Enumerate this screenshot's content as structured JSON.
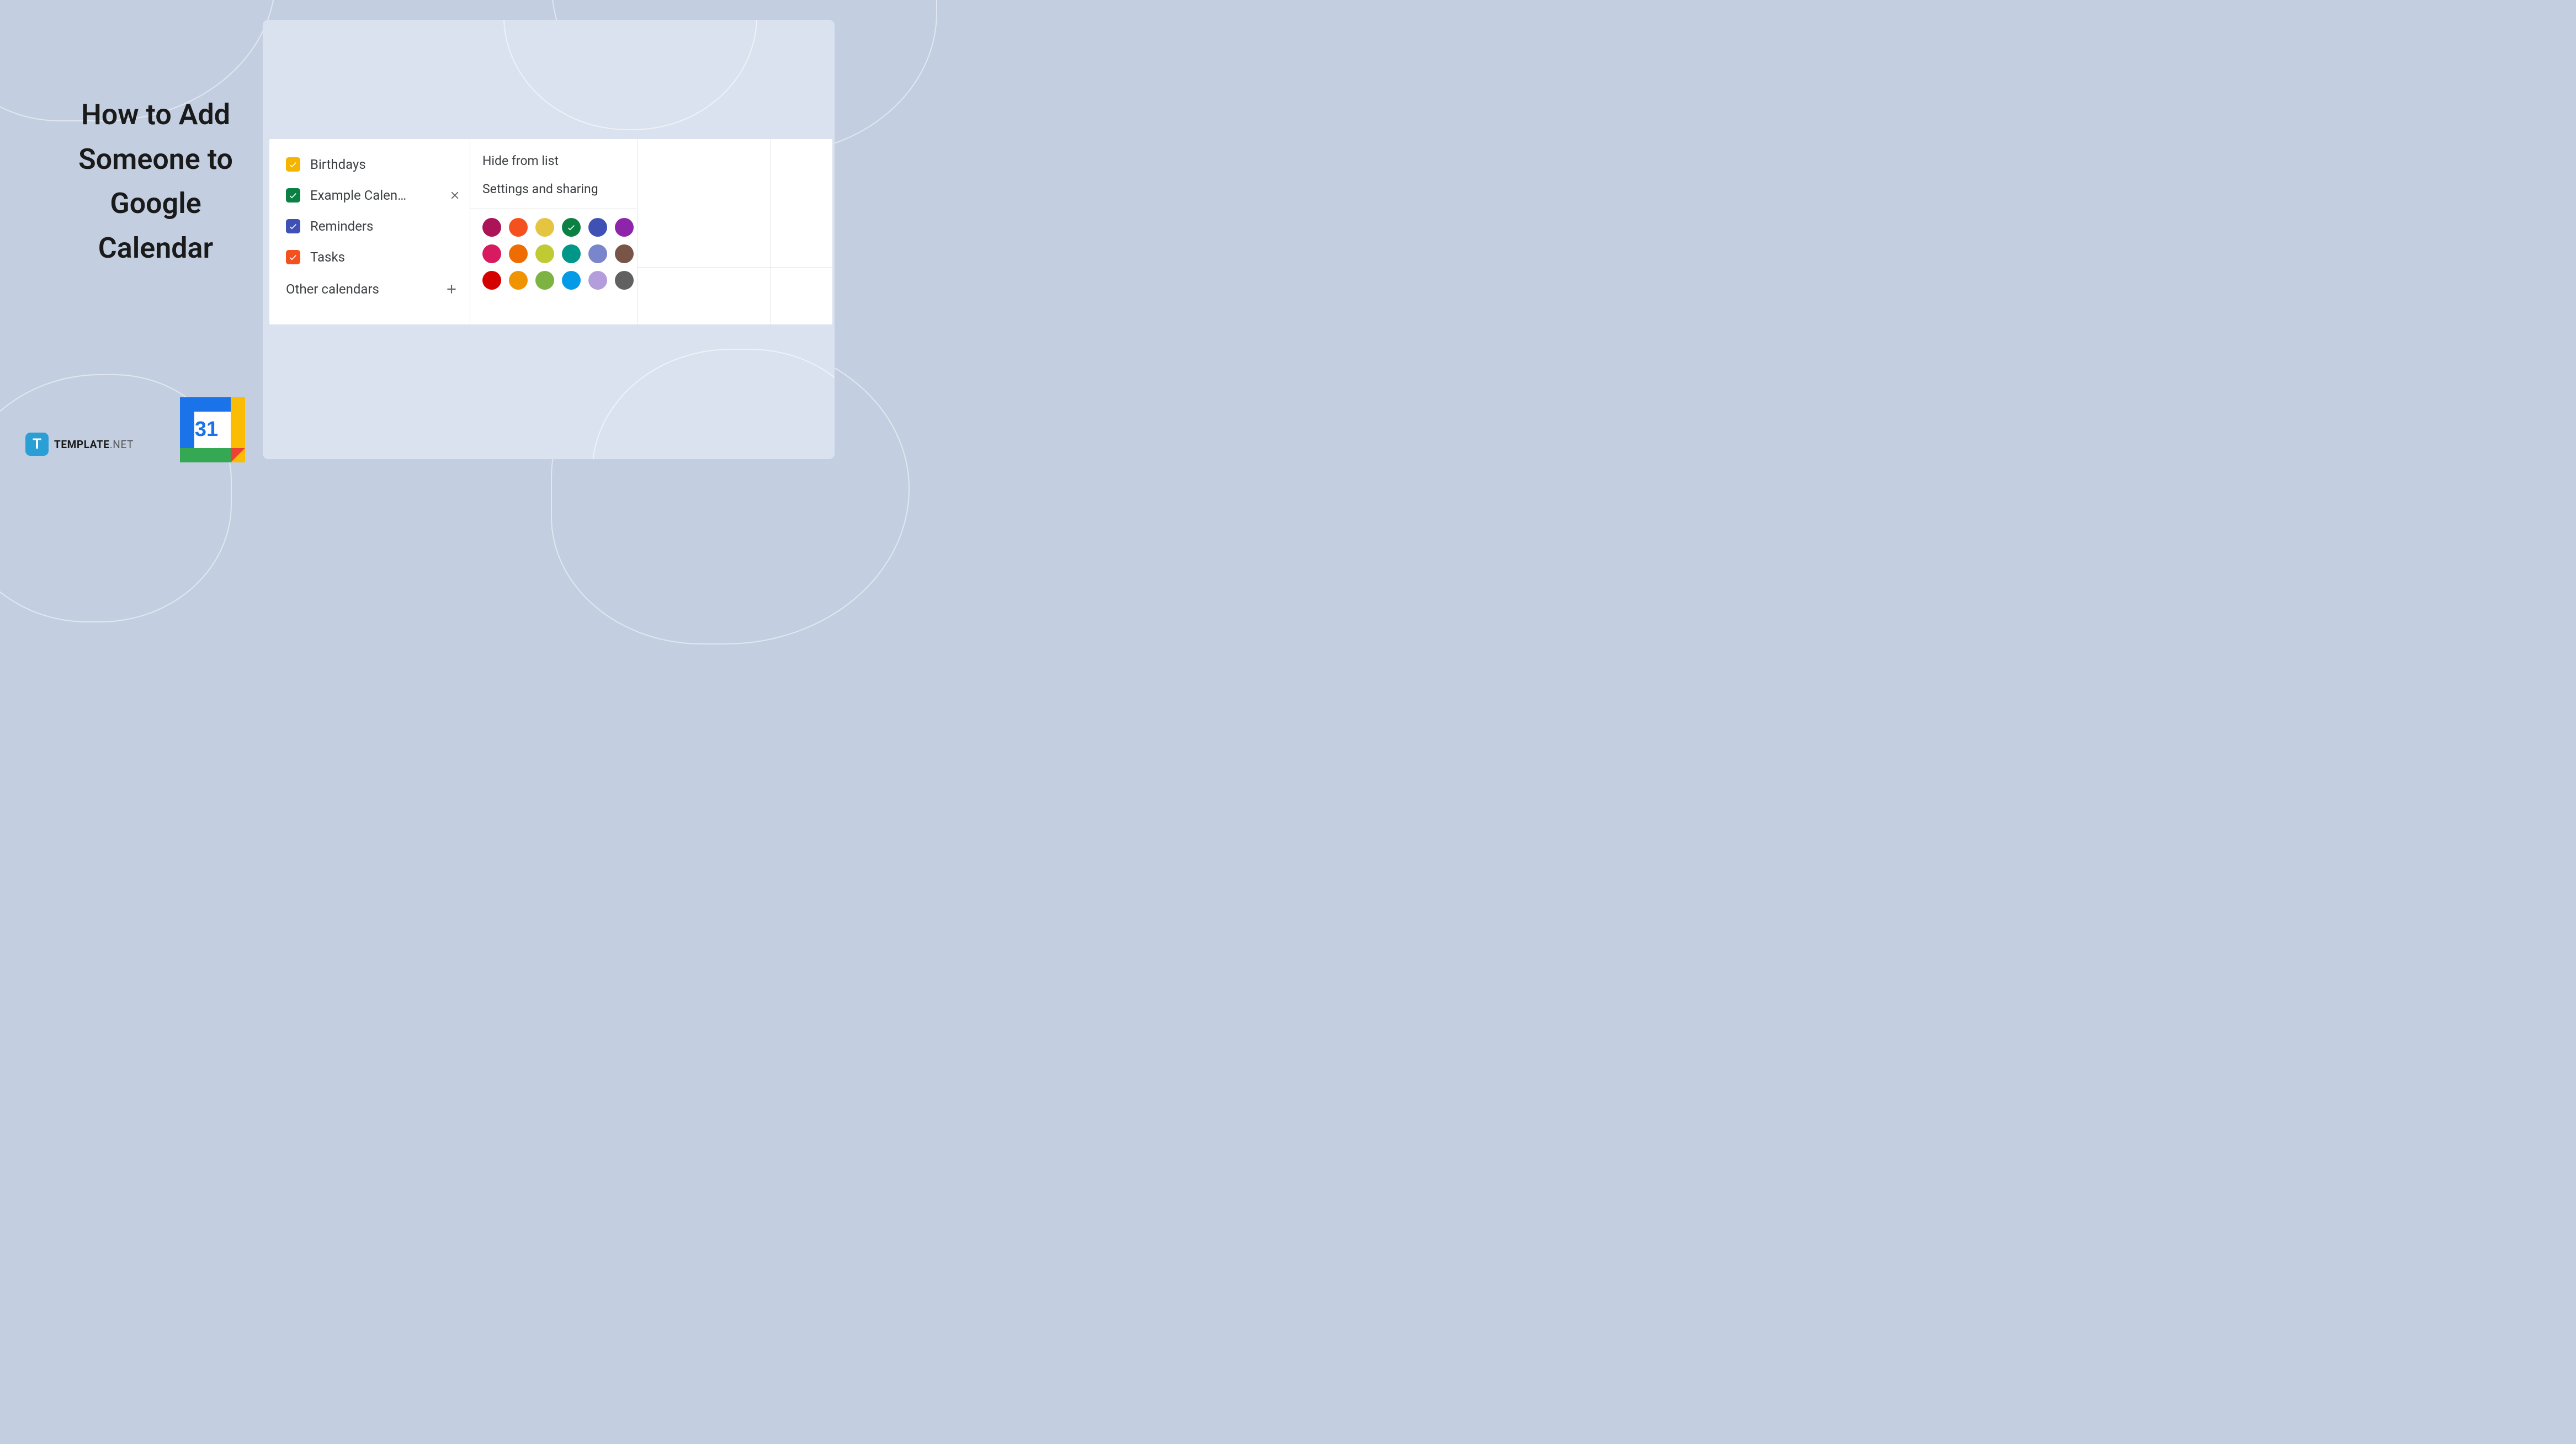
{
  "heading": "How to Add Someone to Google Calendar",
  "brand": {
    "logo_letter": "T",
    "name": "TEMPLATE",
    "suffix": ".NET"
  },
  "gcal_logo": {
    "day": "31"
  },
  "calendars": [
    {
      "label": "Birthdays",
      "color": "#f5b400",
      "checked": true,
      "active": false
    },
    {
      "label": "Example Calen…",
      "color": "#0b8043",
      "checked": true,
      "active": true
    },
    {
      "label": "Reminders",
      "color": "#3f51b5",
      "checked": true,
      "active": false
    },
    {
      "label": "Tasks",
      "color": "#f4511e",
      "checked": true,
      "active": false
    }
  ],
  "other_calendars_label": "Other calendars",
  "context_menu": {
    "hide_label": "Hide from list",
    "settings_label": "Settings and sharing",
    "colors": [
      "#ad1457",
      "#f4511e",
      "#e4c441",
      "#0b8043",
      "#3f51b5",
      "#8e24aa",
      "#d81b60",
      "#ef6c00",
      "#c0ca33",
      "#009688",
      "#7986cb",
      "#795548",
      "#d50000",
      "#f09300",
      "#7cb342",
      "#039be5",
      "#b39ddb",
      "#616161"
    ],
    "selected_color_index": 3
  }
}
